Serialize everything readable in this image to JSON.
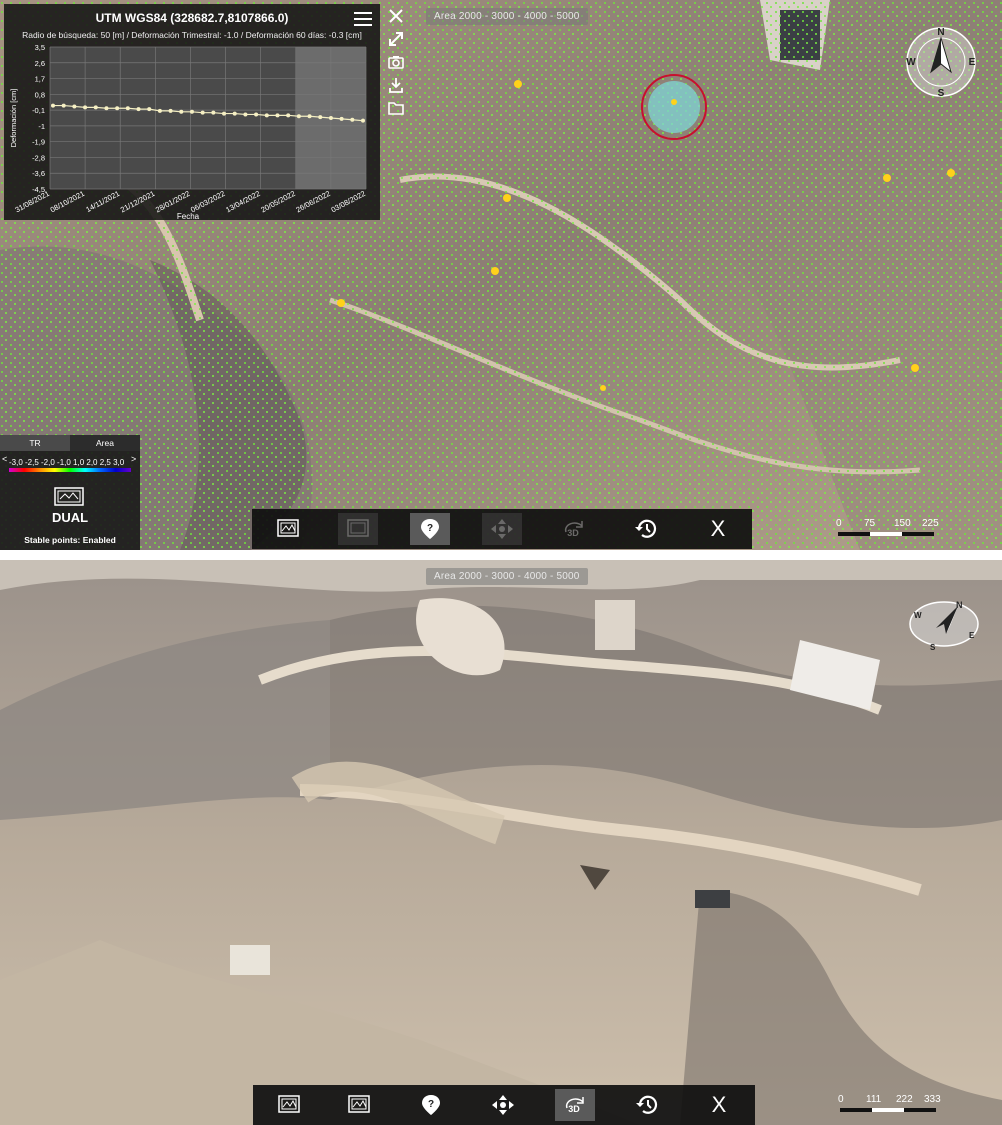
{
  "top_view": {
    "area_label": "Area 2000 - 3000 - 4000 - 5000",
    "chart_panel": {
      "title": "UTM WGS84 (328682.7,8107866.0)",
      "subtitle": "Radio de búsqueda: 50 [m] / Deformación Trimestral: -1.0 / Deformación 60 días: -0.3 [cm]"
    },
    "chart_data": {
      "type": "line",
      "title": "UTM WGS84 (328682.7,8107866.0)",
      "xlabel": "Fecha",
      "ylabel": "Deformación [cm]",
      "ylim": [
        -4.5,
        3.5
      ],
      "yticks": [
        "3,5",
        "2,6",
        "1,7",
        "0,8",
        "-0,1",
        "-1",
        "-1,9",
        "-2,8",
        "-3,6",
        "-4,5"
      ],
      "xticks": [
        "31/08/2021",
        "08/10/2021",
        "14/11/2021",
        "21/12/2021",
        "28/01/2022",
        "06/03/2022",
        "13/04/2022",
        "20/05/2022",
        "26/06/2022",
        "03/08/2022"
      ],
      "grid": true,
      "shaded_region": [
        "20/05/2022",
        "03/08/2022"
      ],
      "series": [
        {
          "values": [
            0.2,
            0.2,
            0.15,
            0.1,
            0.1,
            0.05,
            0.05,
            0.05,
            0.0,
            0.0,
            -0.1,
            -0.1,
            -0.15,
            -0.15,
            -0.2,
            -0.2,
            -0.25,
            -0.25,
            -0.3,
            -0.3,
            -0.35,
            -0.35,
            -0.35,
            -0.4,
            -0.4,
            -0.45,
            -0.5,
            -0.55,
            -0.6,
            -0.65
          ]
        }
      ]
    },
    "legend": {
      "tabs": [
        "TR",
        "Area"
      ],
      "active_tab": "TR",
      "arrow_left": "<",
      "arrow_right": ">",
      "tick_values": "-3,0 -2,5 -2,0 -1,0 1,0 2,0 2,5 3,0",
      "mode_label": "DUAL",
      "stable_points": "Stable points: Enabled"
    },
    "toolbar": {
      "close_label": "X",
      "threeD_label": "3D"
    },
    "scale_labels": [
      "0",
      "75",
      "150",
      "225"
    ],
    "compass": {
      "n": "N",
      "s": "S",
      "e": "E",
      "w": "W"
    }
  },
  "bottom_view": {
    "area_label": "Area 2000 - 3000 - 4000 - 5000",
    "toolbar": {
      "close_label": "X",
      "threeD_label": "3D"
    },
    "scale_labels": [
      "0",
      "111",
      "222",
      "333"
    ],
    "compass": {
      "n": "N",
      "s": "S",
      "e": "E",
      "w": "W"
    }
  }
}
